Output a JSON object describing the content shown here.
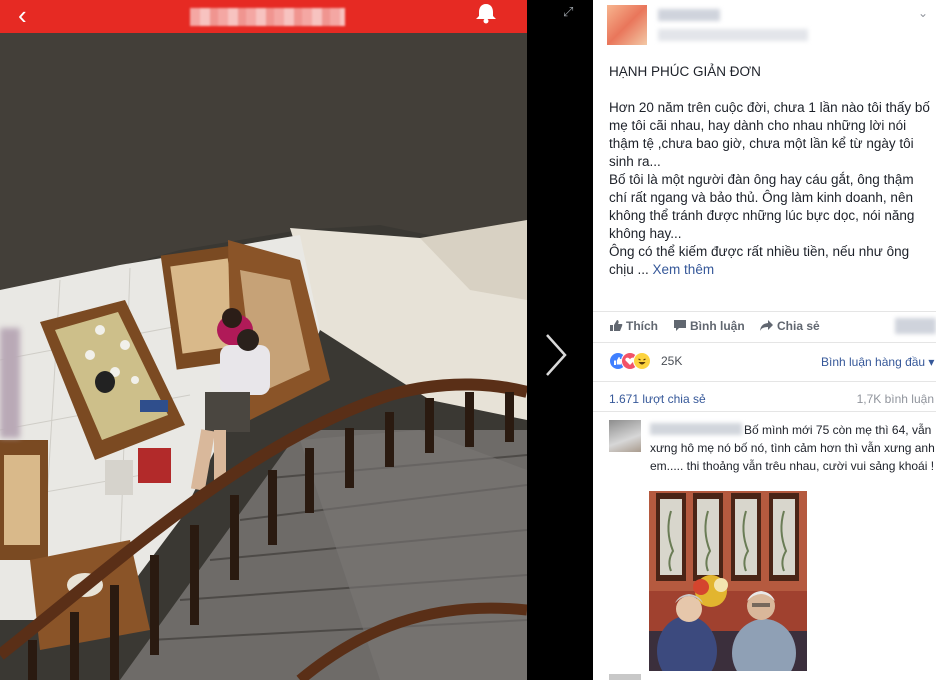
{
  "viewer": {
    "back_icon": "back-arrow-icon",
    "bell_icon": "bell-icon",
    "expand_icon": "expand-icon",
    "next_icon": "chevron-right-icon",
    "header_color": "#e62a23"
  },
  "post": {
    "title": "HẠNH PHÚC GIẢN ĐƠN",
    "body_1": "Hơn 20 năm trên cuộc đời, chưa 1 lần nào tôi thấy bố mẹ tôi cãi nhau, hay dành cho nhau những lời nói thậm tệ ,chưa bao giờ, chưa một lần kể từ ngày tôi sinh ra...",
    "body_2": "Bố tôi là một người đàn ông hay cáu gắt, ông thậm chí rất ngang và bảo thủ. Ông làm kinh doanh, nên không thể tránh được những lúc bực dọc, nói năng không hay...",
    "body_3": "Ông có thể kiếm được rất nhiều tiền, nếu như ông chịu ...",
    "see_more": "Xem thêm"
  },
  "actions": {
    "like": "Thích",
    "comment": "Bình luận",
    "share": "Chia sẻ"
  },
  "reactions": {
    "count": "25K",
    "comment_order": "Bình luận hàng đầu ▾"
  },
  "stats": {
    "shares": "1.671 lượt chia sẻ",
    "comments": "1,7K bình luận"
  },
  "comment": {
    "text": "Bố mình mới 75 còn mẹ thì 64, vẫn xưng hô mẹ nó bố nó, tình cảm hơn thì vẫn xưng anh em..... thi thoảng vẫn trêu nhau, cười vui sảng khoái !"
  }
}
